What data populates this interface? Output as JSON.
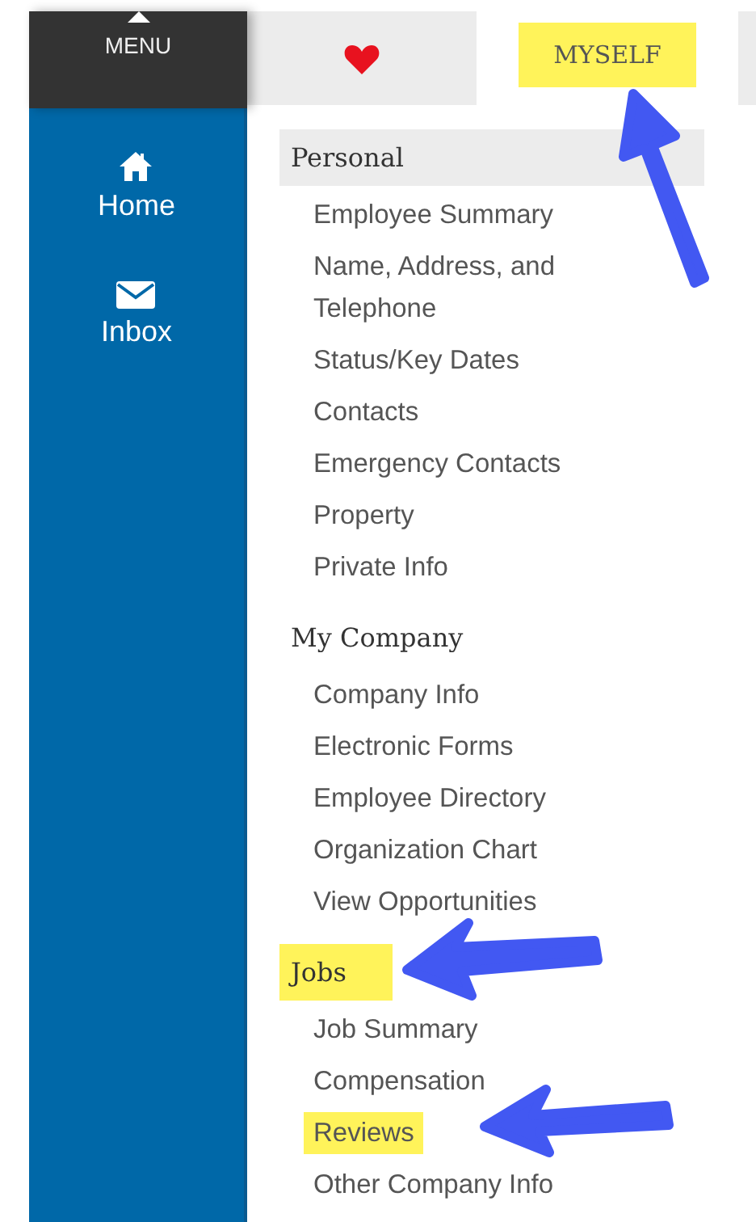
{
  "menu": {
    "label": "MENU"
  },
  "nav": [
    {
      "kind": "home",
      "label": "Home"
    },
    {
      "kind": "inbox",
      "label": "Inbox"
    }
  ],
  "tabs": [
    {
      "kind": "heart"
    },
    {
      "kind": "text",
      "label": "MYSELF",
      "highlighted": true
    },
    {
      "kind": "blank"
    }
  ],
  "sections": [
    {
      "title": "Personal",
      "shaded": true,
      "highlighted": false,
      "items": [
        {
          "label": "Employee Summary",
          "highlighted": false
        },
        {
          "label": "Name, Address, and Telephone",
          "highlighted": false
        },
        {
          "label": "Status/Key Dates",
          "highlighted": false
        },
        {
          "label": "Contacts",
          "highlighted": false
        },
        {
          "label": "Emergency Contacts",
          "highlighted": false
        },
        {
          "label": "Property",
          "highlighted": false
        },
        {
          "label": "Private Info",
          "highlighted": false
        }
      ]
    },
    {
      "title": "My Company",
      "shaded": false,
      "highlighted": false,
      "items": [
        {
          "label": "Company Info",
          "highlighted": false
        },
        {
          "label": "Electronic Forms",
          "highlighted": false
        },
        {
          "label": "Employee Directory",
          "highlighted": false
        },
        {
          "label": "Organization Chart",
          "highlighted": false
        },
        {
          "label": "View Opportunities",
          "highlighted": false
        }
      ]
    },
    {
      "title": "Jobs",
      "shaded": false,
      "highlighted": true,
      "items": [
        {
          "label": "Job Summary",
          "highlighted": false
        },
        {
          "label": "Compensation",
          "highlighted": false
        },
        {
          "label": "Reviews",
          "highlighted": true
        },
        {
          "label": "Other Company Info",
          "highlighted": false
        }
      ]
    }
  ]
}
